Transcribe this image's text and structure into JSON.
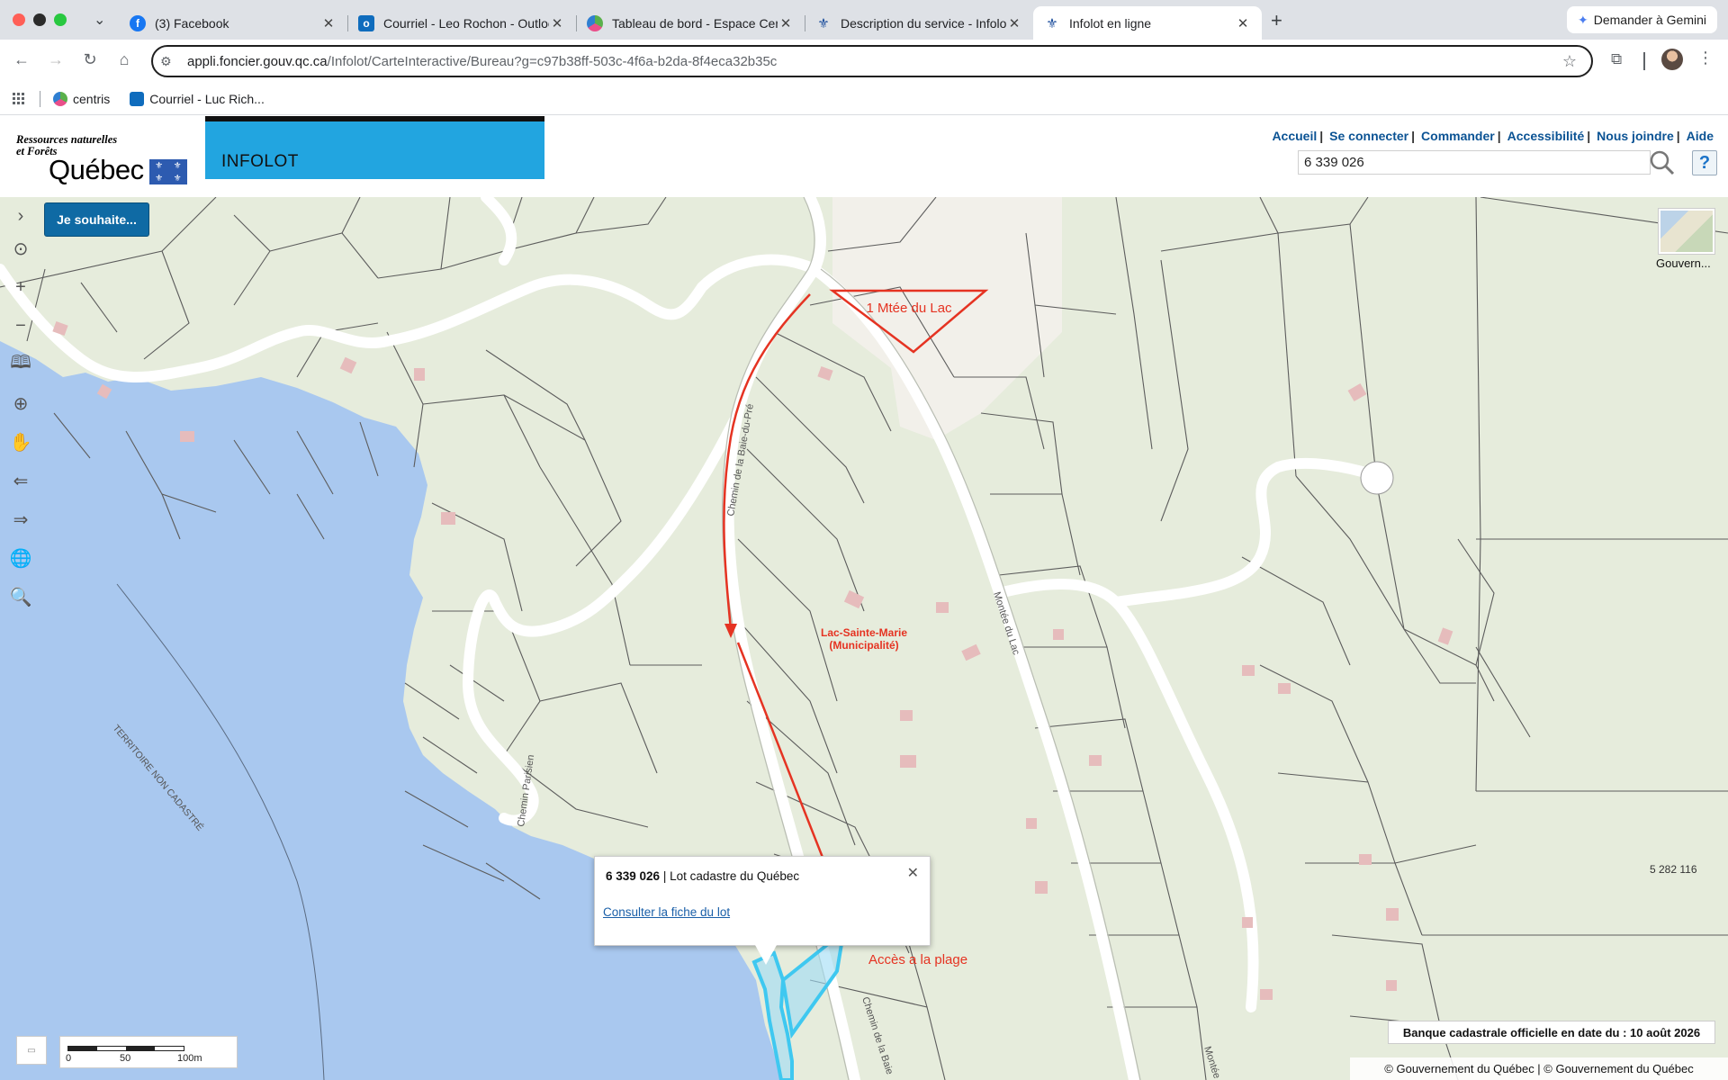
{
  "browser": {
    "tabs": [
      {
        "title": "(3) Facebook",
        "icon": "facebook-icon",
        "color": "#1877f2"
      },
      {
        "title": "Courriel - Leo Rochon - Outlook",
        "icon": "outlook-icon",
        "color": "#0f6cbd"
      },
      {
        "title": "Tableau de bord - Espace Centris",
        "icon": "centris-icon",
        "color": "#5ab04b"
      },
      {
        "title": "Description du service - Infolot",
        "icon": "quebec-icon",
        "color": "#1d4e9c"
      },
      {
        "title": "Infolot en ligne",
        "icon": "quebec-icon",
        "color": "#1d4e9c",
        "active": true
      }
    ],
    "gemini_label": "Demander à Gemini",
    "url_host": "appli.foncier.gouv.qc.ca",
    "url_path": "/Infolot/CarteInteractive/Bureau?g=c97b38ff-503c-4f6a-b2da-8f4eca32b35c",
    "bookmarks": [
      {
        "label": "centris",
        "color": "#5ab04b"
      },
      {
        "label": "Courriel - Luc Rich...",
        "color": "#0f6cbd"
      }
    ]
  },
  "header": {
    "logo_line1": "Ressources naturelles",
    "logo_line2": "et Forêts",
    "logo_name": "Québec",
    "app_name": "INFOLOT",
    "links": [
      "Accueil",
      "Se connecter",
      "Commander",
      "Accessibilité",
      "Nous joindre",
      "Aide"
    ],
    "search_value": "6 339 026",
    "help_label": "?"
  },
  "map": {
    "wish_button": "Je souhaite...",
    "basemap_label": "Gouvern...",
    "labels": {
      "road_baie": "Chemin de la Baie-du-Pré",
      "road_parisien": "Chemin Parisien",
      "road_montee": "Montée du Lac",
      "road_montee2": "Montée",
      "road_baie_bottom": "Chemin de la Baie",
      "municipality_line1": "Lac-Sainte-Marie",
      "municipality_line2": "(Municipalité)",
      "territory": "TERRITOIRE NON CADASTRÉ",
      "lot_right": "5 282 116",
      "annotation_top": "1 Mtée du Lac",
      "annotation_beach": "Accès a la plage"
    },
    "popup": {
      "lot_number": "6 339 026",
      "lot_type": " | Lot cadastre du Québec",
      "link": "Consulter la fiche du lot"
    },
    "scale": {
      "l0": "0",
      "l1": "50",
      "l2": "100m"
    },
    "bank_date": "Banque cadastrale officielle en date du : 10 août 2026",
    "copyright": "© Gouvernement du Québec | © Gouvernement du Québec",
    "colors": {
      "water": "#a9c8ef",
      "land": "#e6ecdc",
      "annotation": "#e53322",
      "selected_lot": "#3fc8f0"
    }
  }
}
